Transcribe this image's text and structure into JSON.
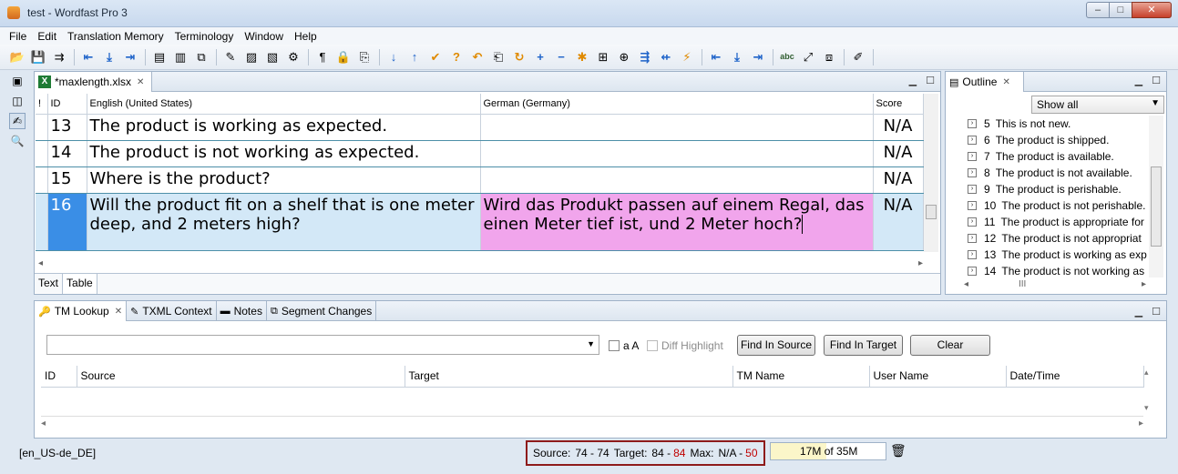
{
  "window": {
    "title": "test - Wordfast Pro 3",
    "buttons": {
      "minimize": "–",
      "maximize": "□",
      "close": "✕"
    }
  },
  "menu": [
    "File",
    "Edit",
    "Translation Memory",
    "Terminology",
    "Window",
    "Help"
  ],
  "toolbar_icons": [
    {
      "name": "open-icon",
      "glyph": "📂"
    },
    {
      "name": "save-icon",
      "glyph": "💾"
    },
    {
      "name": "export-icon",
      "glyph": "⇉"
    },
    {
      "name": "arrow-left-icon",
      "glyph": "⇤"
    },
    {
      "name": "arrow-down-icon",
      "glyph": "⤓"
    },
    {
      "name": "arrow-right-icon",
      "glyph": "⇥"
    },
    {
      "name": "document-icon",
      "glyph": "▤"
    },
    {
      "name": "columns-icon",
      "glyph": "▥"
    },
    {
      "name": "layout-icon",
      "glyph": "⧉"
    },
    {
      "name": "highlighter-icon",
      "glyph": "✎"
    },
    {
      "name": "package-icon",
      "glyph": "▨"
    },
    {
      "name": "package-add-icon",
      "glyph": "▧"
    },
    {
      "name": "settings-gear-icon",
      "glyph": "⚙"
    },
    {
      "name": "pilcrow-icon",
      "glyph": "¶"
    },
    {
      "name": "lock-icon",
      "glyph": "🔒"
    },
    {
      "name": "bookmark-icon",
      "glyph": "⎘"
    },
    {
      "name": "down-arrow-icon",
      "glyph": "↓"
    },
    {
      "name": "up-arrow-icon",
      "glyph": "↑"
    },
    {
      "name": "commit-icon",
      "glyph": "✔"
    },
    {
      "name": "question-icon",
      "glyph": "?"
    },
    {
      "name": "undo-icon",
      "glyph": "↶"
    },
    {
      "name": "copy-source-icon",
      "glyph": "⎗"
    },
    {
      "name": "loop-icon",
      "glyph": "↻"
    },
    {
      "name": "plus-icon",
      "glyph": "+"
    },
    {
      "name": "minus-icon",
      "glyph": "−"
    },
    {
      "name": "asterisk-icon",
      "glyph": "✱"
    },
    {
      "name": "tag-icon",
      "glyph": "⊞"
    },
    {
      "name": "tag-add-icon",
      "glyph": "⊕"
    },
    {
      "name": "merge-icon",
      "glyph": "⇶"
    },
    {
      "name": "split-icon",
      "glyph": "⇷"
    },
    {
      "name": "lightning-icon",
      "glyph": "⚡"
    },
    {
      "name": "first-icon",
      "glyph": "⇤"
    },
    {
      "name": "last-down-icon",
      "glyph": "⤓"
    },
    {
      "name": "end-icon",
      "glyph": "⇥"
    },
    {
      "name": "spellcheck-icon",
      "glyph": "abc"
    },
    {
      "name": "expand-icon",
      "glyph": "⤢"
    },
    {
      "name": "preview-icon",
      "glyph": "⧈"
    },
    {
      "name": "notes-edit-icon",
      "glyph": "✐"
    }
  ],
  "editor": {
    "tab_label": "*maxlength.xlsx",
    "columns": {
      "flag": "!",
      "id": "ID",
      "source": "English (United States)",
      "target": "German (Germany)",
      "score": "Score"
    },
    "rows": [
      {
        "id": "13",
        "source": "The product is working as expected.",
        "target": "",
        "score": "N/A"
      },
      {
        "id": "14",
        "source": "The product is not working as expected.",
        "target": "",
        "score": "N/A"
      },
      {
        "id": "15",
        "source": "Where is the product?",
        "target": "",
        "score": "N/A"
      },
      {
        "id": "16",
        "source": "Will the product fit on a shelf that is one meter deep, and 2 meters high?",
        "target": "Wird das Produkt passen auf einem Regal, das einen Meter tief ist, und 2 Meter hoch?",
        "score": "N/A"
      }
    ],
    "view_tabs": [
      "Text",
      "Table"
    ]
  },
  "outline": {
    "tab_label": "Outline",
    "filter": "Show all",
    "items": [
      {
        "num": "5",
        "text": "This is not new."
      },
      {
        "num": "6",
        "text": "The product is shipped."
      },
      {
        "num": "7",
        "text": "The product is available."
      },
      {
        "num": "8",
        "text": "The product is not available."
      },
      {
        "num": "9",
        "text": "The product is perishable."
      },
      {
        "num": "10",
        "text": "The product is not perishable."
      },
      {
        "num": "11",
        "text": "The product is appropriate for"
      },
      {
        "num": "12",
        "text": "The product is not appropriat"
      },
      {
        "num": "13",
        "text": "The product is working as exp"
      },
      {
        "num": "14",
        "text": "The product is not working as"
      }
    ]
  },
  "tm_panel": {
    "tabs": [
      {
        "label": "TM Lookup",
        "icon": "tm-lookup-icon"
      },
      {
        "label": "TXML Context",
        "icon": "context-icon"
      },
      {
        "label": "Notes",
        "icon": "notes-icon"
      },
      {
        "label": "Segment Changes",
        "icon": "changes-icon"
      }
    ],
    "search_value": "",
    "match_case_label": "a A",
    "diff_highlight_label": "Diff Highlight",
    "find_source_label": "Find In Source",
    "find_target_label": "Find In Target",
    "clear_label": "Clear",
    "columns": [
      "ID",
      "Source",
      "Target",
      "TM Name",
      "User Name",
      "Date/Time"
    ]
  },
  "status": {
    "language_pair": "[en_US-de_DE]",
    "source_label": "Source:",
    "source_value": "74 - 74",
    "target_label": "Target:",
    "target_value": "84 -",
    "target_red": "84",
    "max_label": "Max:",
    "max_value": "N/A -",
    "max_red": "50",
    "memory_used": "17M",
    "memory_sep": "of",
    "memory_total": "35M",
    "memory_fraction": 0.486
  },
  "colors": {
    "current_row": "#d3e8f7",
    "current_id": "#3a8ee6",
    "target_cell": "#f1a5ec",
    "warn": "#c00000",
    "highlight_border": "#8e1b1b"
  }
}
